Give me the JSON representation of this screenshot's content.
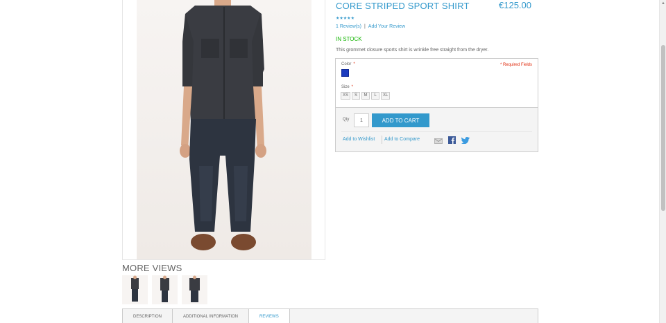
{
  "product": {
    "name": "CORE STRIPED SPORT SHIRT",
    "price": "€125.00",
    "rating_stars": 5,
    "reviews_link": "1 Review(s)",
    "review_separator": "|",
    "add_review_link": "Add Your Review",
    "stock": "IN STOCK",
    "description": "This grommet closure sports shirt is wrinkle free straight from the dryer."
  },
  "options": {
    "color_label": "Color",
    "required_mark": "*",
    "required_note": "* Required Fields",
    "color_swatch": "#1c3cbf",
    "size_label": "Size",
    "sizes": [
      "XS",
      "S",
      "M",
      "L",
      "XL"
    ]
  },
  "cart": {
    "qty_label": "Qty",
    "qty_value": "1",
    "add_to_cart_label": "ADD TO CART",
    "wishlist_link": "Add to Wishlist",
    "compare_link": "Add to Compare",
    "share_icons": [
      "email-icon",
      "facebook-icon",
      "twitter-icon"
    ]
  },
  "gallery": {
    "more_views_title": "MORE VIEWS",
    "thumbnail_count": 3
  },
  "tabs": [
    {
      "label": "DESCRIPTION",
      "active": false
    },
    {
      "label": "ADDITIONAL INFORMATION",
      "active": false
    },
    {
      "label": "REVIEWS",
      "active": true
    }
  ],
  "colors": {
    "accent": "#3399cc",
    "in_stock": "#11b400",
    "required": "#df280a",
    "text": "#636363"
  }
}
